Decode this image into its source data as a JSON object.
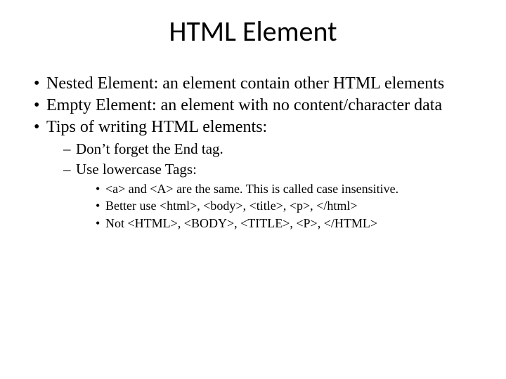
{
  "title": "HTML Element",
  "bullets": [
    {
      "text": "Nested Element: an element contain other HTML elements"
    },
    {
      "text": "Empty Element: an element with no content/character data"
    },
    {
      "text": "Tips of writing HTML elements:",
      "sub": [
        {
          "text": "Don’t forget the End tag."
        },
        {
          "text": "Use lowercase Tags:",
          "sub": [
            {
              "text": "<a> and <A> are the same. This is called case insensitive."
            },
            {
              "text": "Better use <html>, <body>, <title>, <p>, </html>"
            },
            {
              "text": "Not <HTML>, <BODY>, <TITLE>, <P>, </HTML>"
            }
          ]
        }
      ]
    }
  ]
}
